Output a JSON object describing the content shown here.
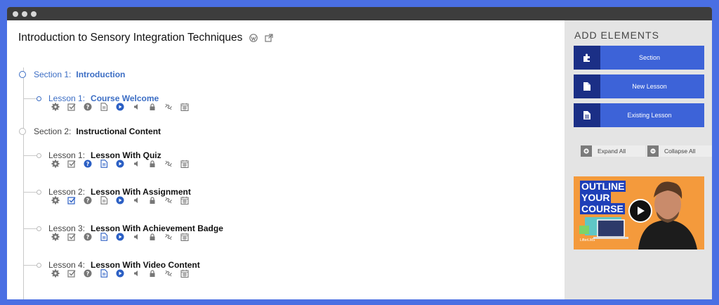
{
  "course": {
    "title": "Introduction to Sensory Integration Techniques",
    "icons": [
      "wordpress-icon",
      "external-link-icon"
    ]
  },
  "sections": [
    {
      "prefix": "Section 1:",
      "name": "Introduction",
      "active": true,
      "lessons": [
        {
          "prefix": "Lesson 1:",
          "name": "Course Welcome",
          "active": true
        }
      ]
    },
    {
      "prefix": "Section 2:",
      "name": "Instructional Content",
      "active": false,
      "lessons": [
        {
          "prefix": "Lesson 1:",
          "name": "Lesson With Quiz",
          "active": false
        },
        {
          "prefix": "Lesson 2:",
          "name": "Lesson With Assignment",
          "active": false
        },
        {
          "prefix": "Lesson 3:",
          "name": "Lesson With Achievement Badge",
          "active": false
        },
        {
          "prefix": "Lesson 4:",
          "name": "Lesson With Video Content",
          "active": false
        }
      ]
    }
  ],
  "lesson_icons": [
    "gear-icon",
    "checkbox-icon",
    "question-icon",
    "document-icon",
    "play-icon",
    "audio-icon",
    "lock-icon",
    "unlink-icon",
    "calendar-icon"
  ],
  "sidebar": {
    "title": "ADD ELEMENTS",
    "buttons": [
      {
        "label": "Section",
        "icon": "puzzle-icon"
      },
      {
        "label": "New Lesson",
        "icon": "file-icon"
      },
      {
        "label": "Existing Lesson",
        "icon": "file-text-icon"
      }
    ],
    "expand_all": "Expand All",
    "collapse_all": "Collapse All",
    "video": {
      "line1": "OUTLINE",
      "line2": "YOUR",
      "line3": "COURSE",
      "brand": "LifterLMS"
    }
  },
  "colors": {
    "accent": "#3b6dc4",
    "button_blue": "#3d63d8",
    "button_dark": "#1b2f86",
    "frame": "#4a6fe3",
    "video_orange": "#f49a3c"
  }
}
